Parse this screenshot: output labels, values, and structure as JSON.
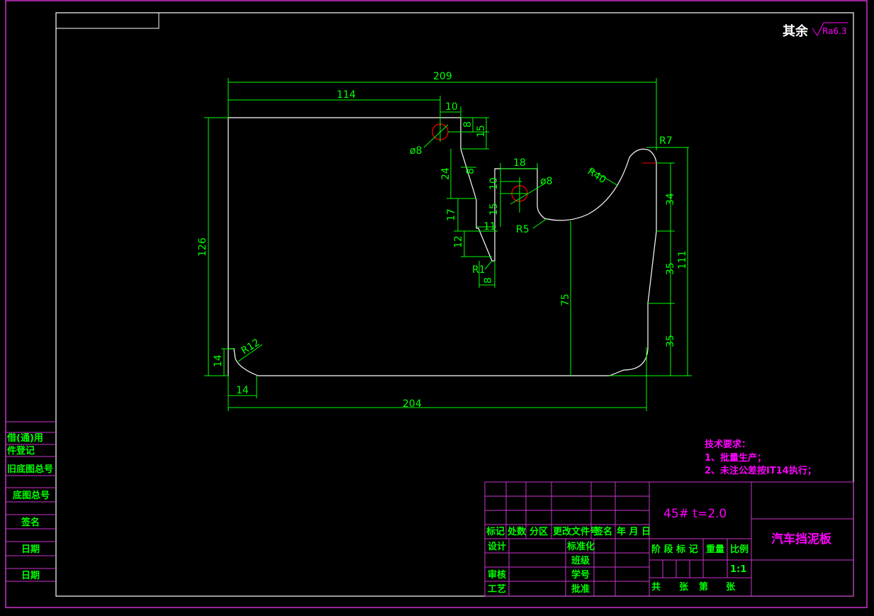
{
  "colors": {
    "background": "#000000",
    "frame": "#cc33cc",
    "dimension": "#00ff00",
    "outline": "#ffffff",
    "accent": "#ff00ff",
    "center_mark": "#ff0000"
  },
  "roughness": {
    "prefix": "其余",
    "symbol": "Ra6.3"
  },
  "dimensions": {
    "width_top": "209",
    "hole_x": "114",
    "hole_offset": "10",
    "hole_y_small": "8",
    "hole_y": "15",
    "hole1_dia": "ø8",
    "slot_a": "24",
    "slot_b": "8",
    "slot_c": "17",
    "slot_d": "11",
    "slot_e": "12",
    "slot_f": "8",
    "r_small": "R1",
    "hole2_x": "18",
    "hole2_dia": "ø8",
    "hole2_a": "10",
    "hole2_b": "15",
    "r40": "R40",
    "r7": "R7",
    "r5": "R5",
    "r12": "R12",
    "right_34": "34",
    "right_35a": "35",
    "right_35b": "35",
    "right_111": "111",
    "left_126": "126",
    "left_14": "14",
    "bottom_14": "14",
    "bottom_204": "204",
    "h_75": "75"
  },
  "tech": {
    "title": "技术要求：",
    "item1": "1、批量生产；",
    "item2": "2、未注公差按IT14执行；"
  },
  "side_labels": [
    "借(通)用",
    "件登记",
    "旧底图总号",
    "底图总号",
    "签名",
    "日期",
    "日期"
  ],
  "title_block": {
    "material": "45#  t=2.0",
    "part_name": "汽车挡泥板",
    "header_row": [
      "标记",
      "处数",
      "分区",
      "更改文件号",
      "签名",
      "年 月 日"
    ],
    "sign_rows": {
      "design": "设计",
      "standard": "标准化",
      "check": "审核",
      "process": "工艺",
      "approve": "批准",
      "class": "班级",
      "student_no": "学号"
    },
    "stage_labels": [
      "阶 段 标 记",
      "重量",
      "比例"
    ],
    "scale": "1:1",
    "sheets": [
      "共",
      "张",
      "第",
      "张"
    ]
  }
}
